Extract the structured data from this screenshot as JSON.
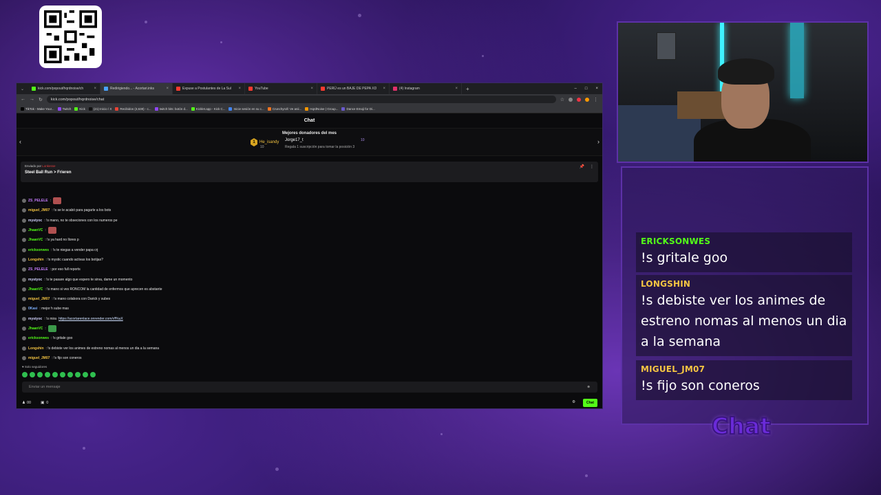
{
  "browser": {
    "tabs": [
      {
        "label": "kick.com/popout/hqrdnoise/ch",
        "active": false,
        "color": "#53fc18"
      },
      {
        "label": "Redirigiendo... - Acortari.inks",
        "active": true,
        "color": "#4aa3ff"
      },
      {
        "label": "Expuse a Postulantes de La Sul",
        "active": false,
        "color": "#ff3b30"
      },
      {
        "label": "YouTube",
        "active": false,
        "color": "#ff3b30"
      },
      {
        "label": "PERÚ es un BAJE DE PEPA XD",
        "active": false,
        "color": "#ff3b30"
      },
      {
        "label": "(4) Instagram",
        "active": false,
        "color": "#e1306c"
      }
    ],
    "new_tab": "+",
    "window_controls": [
      "–",
      "□",
      "×"
    ],
    "url": "kick.com/popout/hqrdnoise/chat",
    "bookmarks": [
      "TikTok - Make Your...",
      "Twitch",
      "Kick",
      "(21) Inicio / X",
      "Recibidos (3,638) - c...",
      "twitch bits: botón d...",
      "Kicklet.app - Kick C...",
      "Inicie sesión en su c...",
      "Crunchyroll: Ve anii...",
      "HqrdNoise | Group...",
      "Dance Emoji for Di..."
    ]
  },
  "chat_page": {
    "header": "Chat",
    "donors_title": "Mejores donadores del mes",
    "donor1": {
      "rank": "1",
      "name": "He_isandy",
      "amount": "10"
    },
    "donor2": {
      "name": "Jorge17_t",
      "amount": "10",
      "note": "Regala 1 suscripción para tomar la posición 3"
    },
    "pinned": {
      "by_label": "Enviado por",
      "by_user": "Lonkesse",
      "title": "Steel Ball Run > Frieren"
    },
    "messages": [
      {
        "user": "ZS_PELELE",
        "color": "#c77dff",
        "text": "",
        "emote": true
      },
      {
        "user": "miguel_JM07",
        "color": "#f5c542",
        "text": ": !s se le acabó para pagarle a los bots"
      },
      {
        "user": "mystyoc",
        "color": "#d4d4ff",
        "text": ": !s mano, no te obseciones con los numeros pe"
      },
      {
        "user": "JhaanVC",
        "color": "#53fc18",
        "text": "",
        "emote": true
      },
      {
        "user": "JhaanVC",
        "color": "#53fc18",
        "text": ": !s ya hard no llores p"
      },
      {
        "user": "ericksonwes",
        "color": "#53fc18",
        "text": ": !s te niegas a vender papa crj"
      },
      {
        "user": "Longshin",
        "color": "#f5c542",
        "text": ": !s mystic cuando activas los botijas?"
      },
      {
        "user": "ZS_PELELE",
        "color": "#c77dff",
        "text": ": por eso full reports"
      },
      {
        "user": "mystyoc",
        "color": "#d4d4ff",
        "text": ": !s te pasare algo que espero te sirva, dame un momento"
      },
      {
        "user": "JhaanVC",
        "color": "#53fc18",
        "text": ": !s mano si ves RONCOM la cantidad de enfermos que aprecen es abstante"
      },
      {
        "user": "miguel_JM07",
        "color": "#f5c542",
        "text": ": !s mano colabora con Darick y subes"
      },
      {
        "user": "0Kasi",
        "color": "#7fb2ff",
        "text": ": mejor h sube mas"
      },
      {
        "user": "mystyoc",
        "color": "#d4d4ff",
        "text": ": !s mira ",
        "link": "https://acortarenlace.onrender.com/r/f%uX"
      },
      {
        "user": "JhaanVC",
        "color": "#53fc18",
        "text": "",
        "emote": true
      },
      {
        "user": "ericksonwes",
        "color": "#53fc18",
        "text": ": !s gritale goo"
      },
      {
        "user": "Longshin",
        "color": "#f5c542",
        "text": ": !s debiste ver los animes de estreno nomas al menos un dia a la semana"
      },
      {
        "user": "miguel_JM07",
        "color": "#f5c542",
        "text": ": !s fijo son coneros"
      }
    ],
    "followers_only": "♥ Solo seguidores",
    "input_placeholder": "Enviar un mensaje",
    "viewers": "00",
    "count": "0",
    "chat_button": "Chat"
  },
  "overlay": {
    "messages": [
      {
        "user": "ERICKSONWES",
        "color": "#53fc18",
        "text": "!s gritale goo"
      },
      {
        "user": "LONGSHIN",
        "color": "#f5c542",
        "text": "!s debiste ver los animes de estreno nomas al menos un dia a la semana"
      },
      {
        "user": "MIGUEL_JM07",
        "color": "#f5c542",
        "text": "!s fijo son coneros"
      }
    ],
    "logo_text": "Chat"
  }
}
